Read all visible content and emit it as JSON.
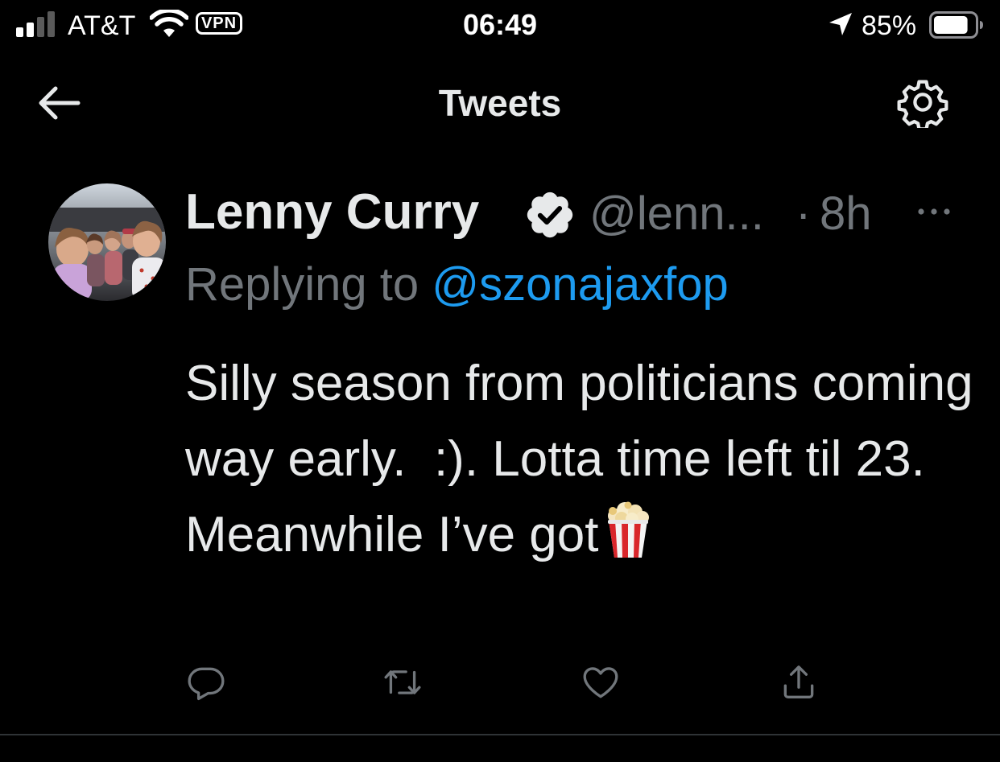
{
  "status_bar": {
    "carrier": "AT&T",
    "vpn_label": "VPN",
    "time": "06:49",
    "battery_percent": "85%",
    "battery_level": 0.85,
    "signal_bars": 2,
    "icons": [
      "signal-icon",
      "wifi-icon",
      "location-arrow-icon",
      "battery-icon"
    ]
  },
  "header": {
    "title": "Tweets",
    "back_icon": "arrow-left-icon",
    "settings_icon": "gear-icon"
  },
  "tweet": {
    "display_name": "Lenny Curry",
    "verified": true,
    "handle": "@lenn...",
    "separator": "·",
    "time_ago": "8h",
    "more_icon": "ellipsis-icon",
    "reply_prefix": "Replying to",
    "reply_to": "@szonajaxfop",
    "text": "Silly season from politicians coming way early.  :). Lotta time left til 23. Meanwhile I’ve got",
    "emoji": "popcorn",
    "actions": [
      "reply-icon",
      "retweet-icon",
      "like-icon",
      "share-icon"
    ]
  },
  "colors": {
    "background": "#000000",
    "text": "#e7e9ea",
    "secondary_text": "#71767b",
    "accent": "#1d9bf0",
    "divider": "#2f3336"
  }
}
